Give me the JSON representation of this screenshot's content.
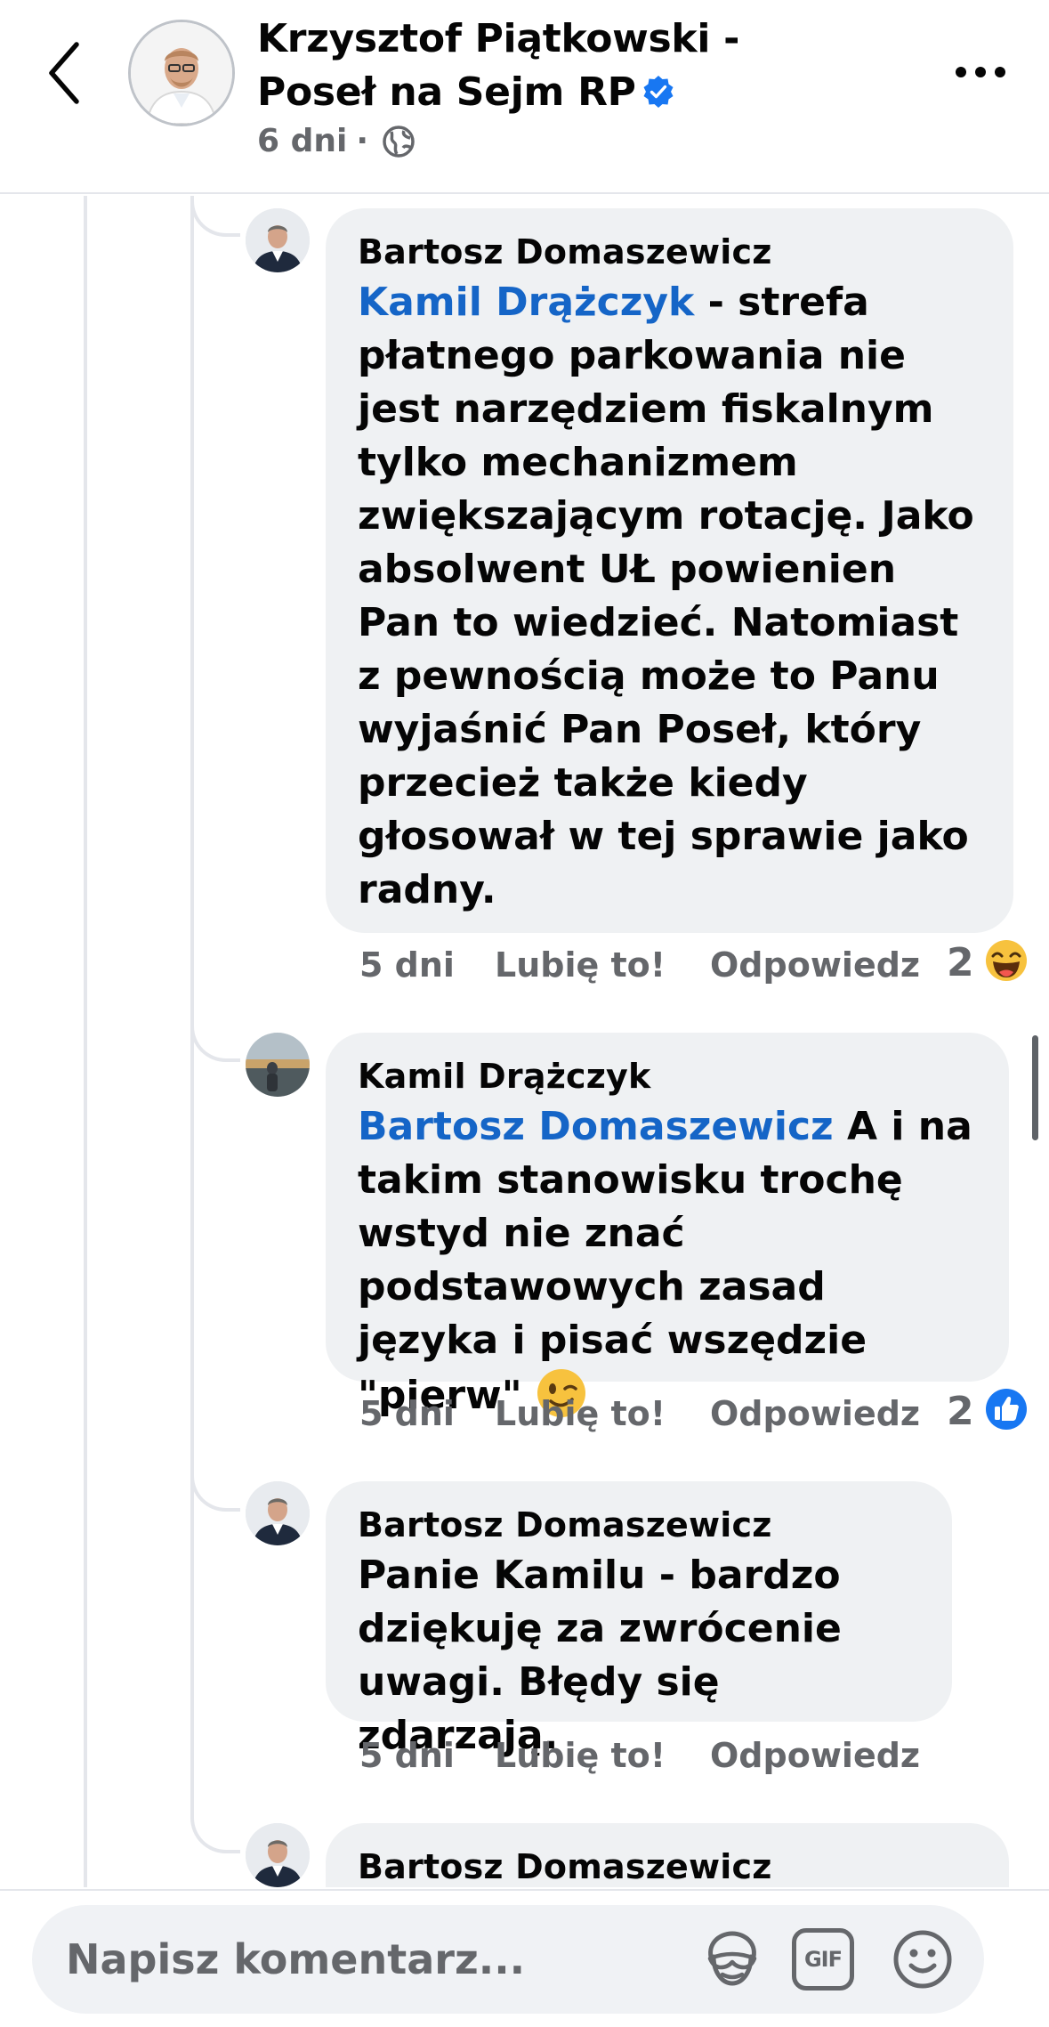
{
  "header": {
    "page_name": "Krzysztof Piątkowski - Poseł na Sejm RP",
    "post_age": "6 dni",
    "separator": "·",
    "back_icon": "chevron-left-icon",
    "more_icon": "more-dots-icon",
    "verified_icon": "verified-badge-icon",
    "privacy_icon": "globe-icon"
  },
  "comments": [
    {
      "author": "Bartosz Domaszewicz",
      "mention": "Kamil Drążczyk",
      "text": " - strefa płatnego parkowania nie jest narzędziem fiskalnym tylko mechanizmem zwiększającym rotację. Jako absolwent UŁ powienien Pan to wiedzieć. Natomiast z pewnością może to Panu wyjaśnić Pan Poseł, który przecież także kiedy głosował w tej sprawie jako radny.",
      "time": "5 dni",
      "like_label": "Lubię to!",
      "reply_label": "Odpowiedz",
      "reaction_count": "2",
      "reaction_icon": "haha-emoji-icon"
    },
    {
      "author": "Kamil Drążczyk",
      "mention": "Bartosz Domaszewicz",
      "text": " A i na takim stanowisku trochę wstyd nie znać podstawowych zasad języka i pisać wszędzie \"pierw\"",
      "inline_emoji": "winking-face-icon",
      "time": "5 dni",
      "like_label": "Lubię to!",
      "reply_label": "Odpowiedz",
      "reaction_count": "2",
      "reaction_icon": "like-thumb-icon"
    },
    {
      "author": "Bartosz Domaszewicz",
      "text": "Panie Kamilu - bardzo dziękuję za zwrócenie uwagi. Błędy się zdarzają.",
      "time": "5 dni",
      "like_label": "Lubię to!",
      "reply_label": "Odpowiedz"
    },
    {
      "author": "Bartosz Domaszewicz"
    }
  ],
  "composer": {
    "placeholder": "Napisz komentarz...",
    "avatar_sticker_icon": "avatar-sticker-icon",
    "gif_label": "GIF",
    "emoji_icon": "smiley-icon"
  },
  "colors": {
    "mention": "#1565c7",
    "bubble": "#eff1f3",
    "meta": "#65676b",
    "verified": "#1877f2",
    "like": "#1877f2"
  }
}
